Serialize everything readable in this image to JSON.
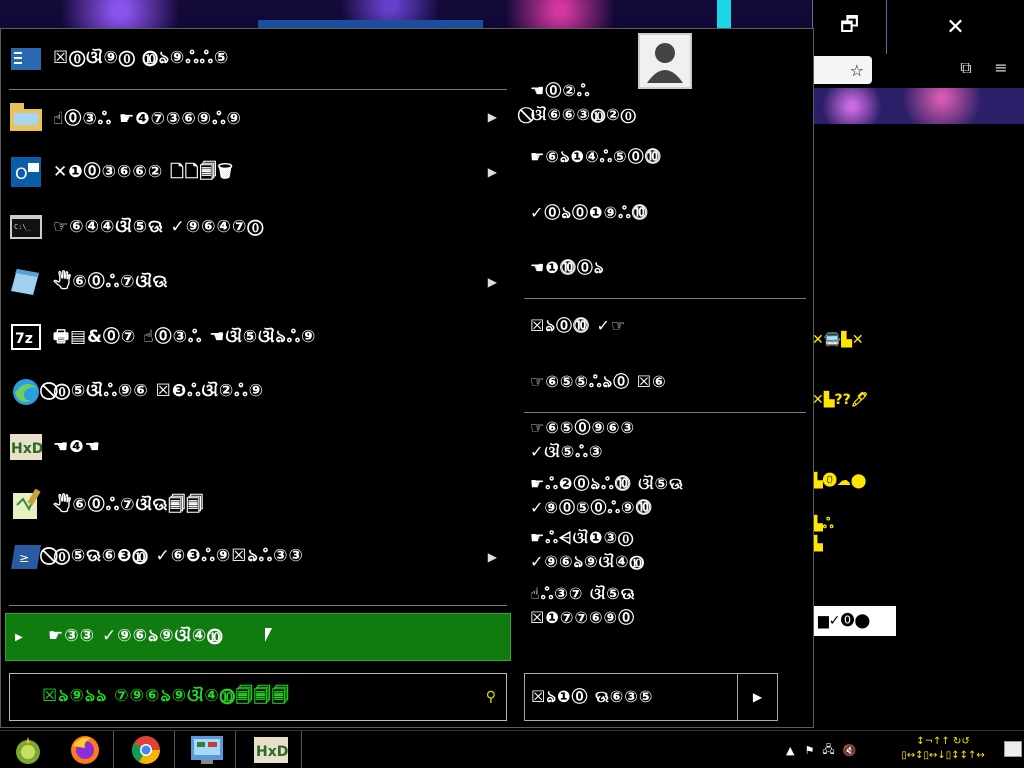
{
  "start_menu": {
    "header": {
      "title": "☒⓪ଔ⑨⓪  ⓾ঌ⑨ஃஃ⑤"
    },
    "left_items": [
      {
        "label": "☝⓪③ஃ  ☛❹⑦③⑥⑨ஃ⑨",
        "icon": "folder-icon",
        "has_arrow": true
      },
      {
        "label": "✕❶⓪③⑥⑥②  🗋🗋🗐🗑",
        "icon": "outlook-icon",
        "has_arrow": true
      },
      {
        "label": "☞⑥④④ଔ⑤ଊ  ✓⑨⑥④⑦⓪",
        "icon": "console-icon",
        "has_arrow": false
      },
      {
        "label": "🖑⑥⓪ஃ⑦ଔଊ",
        "icon": "notepad-icon",
        "has_arrow": true
      },
      {
        "label": "🖶▤&⓪⑦  ☝⓪③ஃ  ☚ଔ⑤ଔঌஃ⑨",
        "icon": "7zip-icon",
        "has_arrow": false
      },
      {
        "label": "⃠⓪⑤ଔஃ⑨⑥  ☒❸ஃଔ②ஃ⑨",
        "icon": "edge-icon",
        "has_arrow": false
      },
      {
        "label": "☚❹☚",
        "icon": "hxd-icon",
        "has_arrow": false
      },
      {
        "label": "🖑⑥⓪ஃ⑦ଔଊ🗐🗐",
        "icon": "notepadpp-icon",
        "has_arrow": false
      },
      {
        "label": "⃠⓪⑤ଊ⑥❸⓾  ✓⑥❸ஃ⑨☒ঌஃ③③",
        "icon": "powershell-icon",
        "has_arrow": true
      }
    ],
    "selected_item": {
      "label": "☛③③  ✓⑨⑥ঌ⑨ଔ④⓾",
      "icon": "chevron-right-icon"
    },
    "search": {
      "value": "☒ঌ⑨ঌঌ  ⑦⑨⑥ঌ⑨ଔ④⓾🗐🗐🗐",
      "icon": "search-icon"
    },
    "right_items": [
      {
        "line1": "☚⓪②ஃ",
        "line2": "⃠ଔ⑥⑥③⓾②⓪"
      },
      {
        "line1": "☛⑥ঌ❶④ஃ⑤⓪⓾"
      },
      {
        "line1": "✓⓪ঌ⓪❶⑨ஃ⓾"
      },
      {
        "line1": "☚❶⓾⓪ঌ"
      },
      {
        "line1": "☒ঌ⓪⓾  ✓☞"
      },
      {
        "line1": "☞⑥⑤⑤ஃঌ⓪  ☒⑥"
      },
      {
        "line1": "☞⑥⑤⓪⑨⑥③",
        "line2": "✓ଔ⑤ஃ③"
      },
      {
        "line1": "☛ஃ❷⓪ঌஃ⓾  ଔ⑤ଊ",
        "line2": "✓⑨⓪⑤⓪ஃ⑨⓾"
      },
      {
        "line1": "☛ஃ⩤ଔ❶③⓪",
        "line2": "✓⑨⑥ঌ⑨ଔ④⓾"
      },
      {
        "line1": "☝ஃ③⑦  ଔ⑤ଊ",
        "line2": "☒❶⑦⑦⑥⑨⓪"
      }
    ],
    "power": {
      "label": "☒ঌ❶⓪  ଊ⑥③⑤",
      "icon": "chevron-right-icon"
    },
    "user_tile_icon": "user-avatar-icon"
  },
  "browser": {
    "restore_icon": "restore-icon",
    "close_icon": "close-icon",
    "star_icon": "star-icon",
    "extensions_icon": "extensions-icon",
    "menu_icon": "hamburger-menu-icon",
    "yellow_texts": [
      "✕🚍▙✕",
      "✕▙??🖊",
      "▙⓿☁⬤",
      "▙ஃ",
      "▙"
    ],
    "white_box_text": "▆✓⓿⬤"
  },
  "taskbar": {
    "apps": [
      {
        "name": "start-button",
        "icon": "start-orb-icon"
      },
      {
        "name": "firefox",
        "icon": "firefox-icon"
      },
      {
        "name": "chrome",
        "icon": "chrome-icon"
      },
      {
        "name": "control-panel",
        "icon": "control-panel-icon"
      },
      {
        "name": "hxd",
        "icon": "hxd-icon"
      }
    ],
    "tray_icons": [
      "chevron-up-icon",
      "flag-icon",
      "network-icon",
      "volume-muted-icon"
    ],
    "clock_line1": "↕¬↑↑  ↻↺",
    "clock_line2": "▯↔↕▯↔↓▯↕↕↑↔",
    "show_desktop_icon": "keyboard-icon"
  }
}
